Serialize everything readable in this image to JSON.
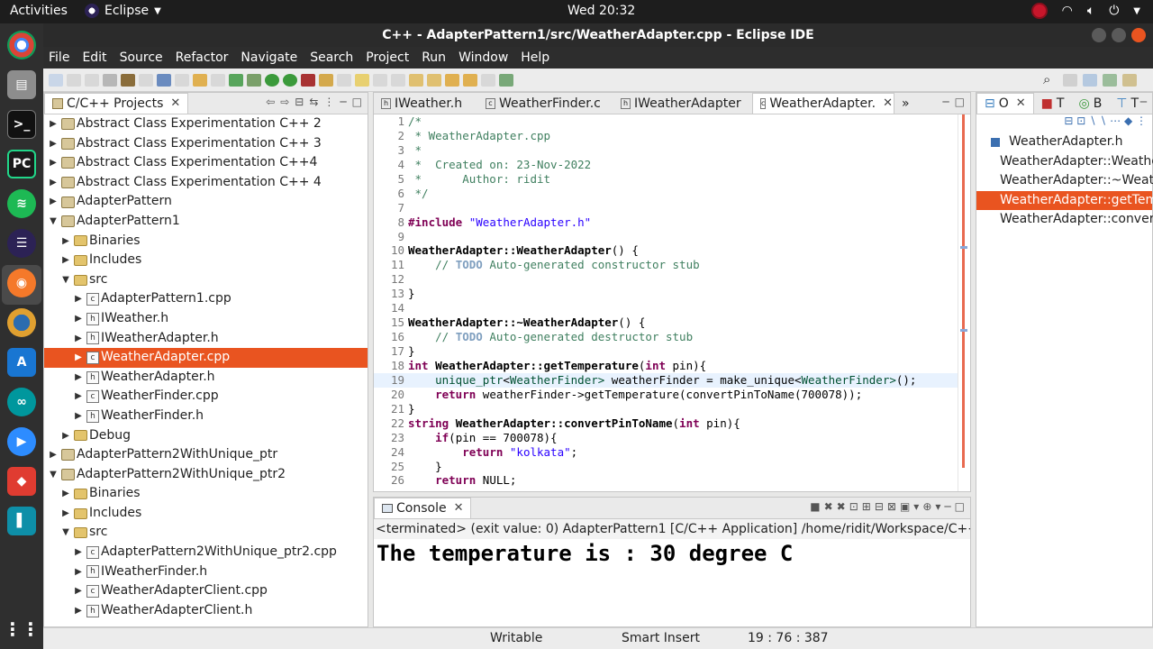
{
  "topbar": {
    "activities": "Activities",
    "app_name": "Eclipse",
    "clock": "Wed 20:32"
  },
  "window": {
    "title": "C++ - AdapterPattern1/src/WeatherAdapter.cpp - Eclipse IDE"
  },
  "menu": [
    "File",
    "Edit",
    "Source",
    "Refactor",
    "Navigate",
    "Search",
    "Project",
    "Run",
    "Window",
    "Help"
  ],
  "project_explorer": {
    "tab_label": "C/C++ Projects",
    "items": [
      {
        "label": "Abstract Class Experimentation C++ 2",
        "level": 0,
        "kind": "project",
        "expanded": false
      },
      {
        "label": "Abstract Class Experimentation C++ 3",
        "level": 0,
        "kind": "project",
        "expanded": false
      },
      {
        "label": "Abstract Class Experimentation C++4",
        "level": 0,
        "kind": "project",
        "expanded": false
      },
      {
        "label": "Abstract Class Experimentation C++ 4",
        "level": 0,
        "kind": "project",
        "expanded": false
      },
      {
        "label": "AdapterPattern",
        "level": 0,
        "kind": "project",
        "expanded": false
      },
      {
        "label": "AdapterPattern1",
        "level": 0,
        "kind": "project",
        "expanded": true
      },
      {
        "label": "Binaries",
        "level": 1,
        "kind": "folder",
        "expanded": false
      },
      {
        "label": "Includes",
        "level": 1,
        "kind": "folder",
        "expanded": false
      },
      {
        "label": "src",
        "level": 1,
        "kind": "folder",
        "expanded": true
      },
      {
        "label": "AdapterPattern1.cpp",
        "level": 2,
        "kind": "cpp",
        "expanded": false
      },
      {
        "label": "IWeather.h",
        "level": 2,
        "kind": "h",
        "expanded": false
      },
      {
        "label": "IWeatherAdapter.h",
        "level": 2,
        "kind": "h",
        "expanded": false
      },
      {
        "label": "WeatherAdapter.cpp",
        "level": 2,
        "kind": "cpp",
        "expanded": false,
        "selected": true
      },
      {
        "label": "WeatherAdapter.h",
        "level": 2,
        "kind": "h",
        "expanded": false
      },
      {
        "label": "WeatherFinder.cpp",
        "level": 2,
        "kind": "cpp",
        "expanded": false
      },
      {
        "label": "WeatherFinder.h",
        "level": 2,
        "kind": "h",
        "expanded": false
      },
      {
        "label": "Debug",
        "level": 1,
        "kind": "folder",
        "expanded": false
      },
      {
        "label": "AdapterPattern2WithUnique_ptr",
        "level": 0,
        "kind": "project",
        "expanded": false
      },
      {
        "label": "AdapterPattern2WithUnique_ptr2",
        "level": 0,
        "kind": "project",
        "expanded": true
      },
      {
        "label": "Binaries",
        "level": 1,
        "kind": "folder",
        "expanded": false
      },
      {
        "label": "Includes",
        "level": 1,
        "kind": "folder",
        "expanded": false
      },
      {
        "label": "src",
        "level": 1,
        "kind": "folder",
        "expanded": true
      },
      {
        "label": "AdapterPattern2WithUnique_ptr2.cpp",
        "level": 2,
        "kind": "cpp",
        "expanded": false
      },
      {
        "label": "IWeatherFinder.h",
        "level": 2,
        "kind": "h",
        "expanded": false
      },
      {
        "label": "WeatherAdapterClient.cpp",
        "level": 2,
        "kind": "cpp",
        "expanded": false
      },
      {
        "label": "WeatherAdapterClient.h",
        "level": 2,
        "kind": "h",
        "expanded": false
      }
    ]
  },
  "editor": {
    "tabs": [
      {
        "label": "IWeather.h",
        "active": false
      },
      {
        "label": "WeatherFinder.c",
        "active": false
      },
      {
        "label": "IWeatherAdapter",
        "active": false
      },
      {
        "label": "WeatherAdapter.",
        "active": true
      }
    ],
    "overflow_count": "»",
    "lines": [
      {
        "n": "1",
        "text": "/*"
      },
      {
        "n": "2",
        "text": " * WeatherAdapter.cpp"
      },
      {
        "n": "3",
        "text": " *"
      },
      {
        "n": "4",
        "text": " *  Created on: 23-Nov-2022"
      },
      {
        "n": "5",
        "text": " *      Author: ridit"
      },
      {
        "n": "6",
        "text": " */"
      },
      {
        "n": "7",
        "text": ""
      },
      {
        "n": "8",
        "text": "#include \"WeatherAdapter.h\""
      },
      {
        "n": "9",
        "text": ""
      },
      {
        "n": "10",
        "text": "WeatherAdapter::WeatherAdapter() {"
      },
      {
        "n": "11",
        "text": "    // TODO Auto-generated constructor stub"
      },
      {
        "n": "12",
        "text": ""
      },
      {
        "n": "13",
        "text": "}"
      },
      {
        "n": "14",
        "text": ""
      },
      {
        "n": "15",
        "text": "WeatherAdapter::~WeatherAdapter() {"
      },
      {
        "n": "16",
        "text": "    // TODO Auto-generated destructor stub"
      },
      {
        "n": "17",
        "text": "}"
      },
      {
        "n": "18",
        "text": "int WeatherAdapter::getTemperature(int pin){"
      },
      {
        "n": "19",
        "text": "    unique_ptr<WeatherFinder> weatherFinder = make_unique<WeatherFinder>();"
      },
      {
        "n": "20",
        "text": "    return weatherFinder->getTemperature(convertPinToName(700078));"
      },
      {
        "n": "21",
        "text": "}"
      },
      {
        "n": "22",
        "text": "string WeatherAdapter::convertPinToName(int pin){"
      },
      {
        "n": "23",
        "text": "    if(pin == 700078){"
      },
      {
        "n": "24",
        "text": "        return \"kolkata\";"
      },
      {
        "n": "25",
        "text": "    }"
      },
      {
        "n": "26",
        "text": "    return NULL;"
      }
    ]
  },
  "outline": {
    "tab_o": "O",
    "tab_t": "T",
    "tab_b": "B",
    "tab_t2": "T",
    "items": [
      {
        "label": "WeatherAdapter.h",
        "kind": "include"
      },
      {
        "label": "WeatherAdapter::Weathe",
        "kind": "method"
      },
      {
        "label": "WeatherAdapter::~Weath",
        "kind": "method"
      },
      {
        "label": "WeatherAdapter::getTem",
        "kind": "method",
        "selected": true
      },
      {
        "label": "WeatherAdapter::convert",
        "kind": "method"
      }
    ]
  },
  "console": {
    "tab_label": "Console",
    "status": "<terminated> (exit value: 0) AdapterPattern1 [C/C++ Application] /home/ridit/Workspace/C++/AdapterPa",
    "output": "The temperature is : 30 degree C"
  },
  "statusbar": {
    "mode": "Writable",
    "insert": "Smart Insert",
    "position": "19 : 76 : 387"
  },
  "colors": {
    "accent": "#e95420",
    "dark_bar": "#2d2d2d"
  }
}
